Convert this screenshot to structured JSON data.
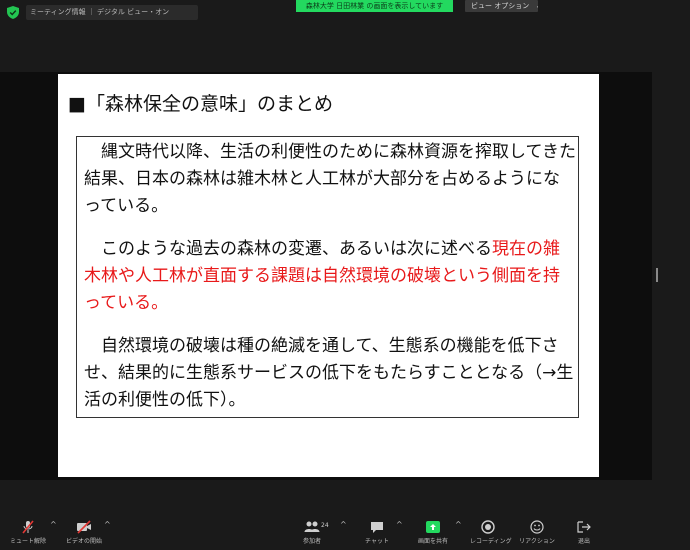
{
  "topbar": {
    "meeting_info": "ミーティング情報 ｜ デジタル ビュー・オン",
    "share_banner": "森林大学 日田林業 の画面を表示しています",
    "view_options_label": "ビュー オプション",
    "view_options_chevron": "⌄"
  },
  "slide": {
    "title": "■「森林保全の意味」のまとめ",
    "paragraphs": [
      {
        "text": "縄文時代以降、生活の利便性のために森林資源を搾取してきた結果、日本の森林は雑木林と人工林が大部分を占めるようになっている。"
      },
      {
        "text_normal": "このような過去の森林の変遷、あるいは次に述べる",
        "text_red": "現在の雑木林や人工林が直面する課題は自然環境の破壊という側面を持っている。"
      },
      {
        "text": "自然環境の破壊は種の絶滅を通して、生態系の機能を低下させ、結果的に生態系サービスの低下をもたらすこととなる（→生活の利便性の低下）。"
      }
    ]
  },
  "toolbar": {
    "mute_label": "ミュート解除",
    "video_label": "ビデオの開始",
    "participants_label": "参加者",
    "participants_count": "24",
    "chat_label": "チャット",
    "share_label": "画面を共有",
    "record_label": "レコーディング",
    "reactions_label": "リアクション",
    "leave_label": "退出",
    "caret": "^"
  },
  "colors": {
    "background": "#1a1a1a",
    "banner_green": "#23d95f",
    "share_icon_green": "#23d95f",
    "mute_slash_red": "#e53935",
    "highlight_red": "#e8191a"
  }
}
